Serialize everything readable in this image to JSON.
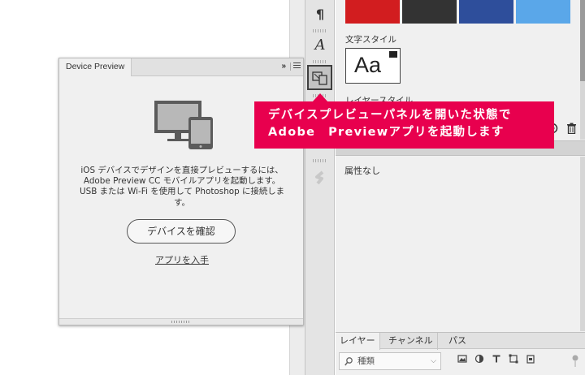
{
  "device_preview": {
    "tab_label": "Device Preview",
    "collapse_glyph": "»",
    "description": "iOS デバイスでデザインを直接プレビューするには、Adobe Preview CC モバイルアプリを起動します。USB または Wi-Fi を使用して Photoshop に接続します。",
    "confirm_button": "デバイスを確認",
    "get_app_link": "アプリを入手",
    "illustration_icon": "devices-icon"
  },
  "tool_strip": {
    "items": [
      {
        "icon": "paragraph-icon",
        "glyph": "¶"
      },
      {
        "icon": "character-icon",
        "glyph": "A"
      },
      {
        "icon": "device-preview-icon",
        "active": true
      },
      {
        "icon": "tool-icon-4"
      },
      {
        "icon": "tool-icon-5"
      },
      {
        "icon": "libraries-icon"
      }
    ]
  },
  "right_panel": {
    "swatch_colors": [
      "#d21d1f",
      "#333333",
      "#2e4e9b",
      "#5aa7e9"
    ],
    "character_style_label": "文字スタイル",
    "aa_sample": "Aa",
    "layer_style_label": "レイヤースタイル",
    "properties_text": "属性なし",
    "layers_tabs": [
      "レイヤー",
      "チャンネル",
      "パス"
    ],
    "filter_placeholder": "種類",
    "filter_icons": [
      "image-filter-icon",
      "adjustment-filter-icon",
      "type-filter-icon",
      "shape-filter-icon",
      "smart-object-filter-icon"
    ]
  },
  "callout": {
    "line1": "デバイスプレビューパネルを開いた状態で",
    "line2": "Adobe　Previewアプリを起動します",
    "color": "#e8004e"
  }
}
